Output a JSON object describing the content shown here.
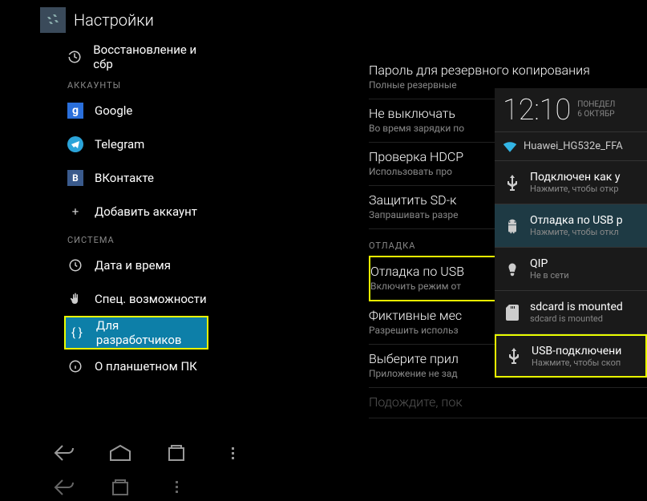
{
  "header": {
    "title": "Настройки"
  },
  "sidebar": {
    "restore": "Восстановление и сбр",
    "sections": {
      "accounts": "Аккаунты",
      "system": "Система"
    },
    "google": "Google",
    "telegram": "Telegram",
    "vk": "ВКонтакте",
    "add_account": "Добавить аккаунт",
    "datetime": "Дата и время",
    "accessibility": "Спец. возможности",
    "developer": "Для разработчиков",
    "about": "О планшетном ПК"
  },
  "content": {
    "backup_pw": {
      "title": "Пароль для резервного копирования",
      "sub": "Полные резервные"
    },
    "stayawake": {
      "title": "Не выключать",
      "sub": "Во время зарядки по"
    },
    "hdcp": {
      "title": "Проверка HDCP",
      "sub": "Использовать про"
    },
    "protect_sd": {
      "title": "Защитить SD-к",
      "sub": "Запрашивать разре"
    },
    "section_debug": "ОТЛАДКА",
    "usb_debug": {
      "title": "Отладка по USB",
      "sub": "Включить режим от"
    },
    "mock_loc": {
      "title": "Фиктивные мес",
      "sub": "Разрешить использ"
    },
    "choose_app": {
      "title": "Выберите прил",
      "sub": "Приложение не зад"
    },
    "wait": {
      "title": "Подождите, пок"
    }
  },
  "clock": {
    "time": "12:10",
    "day": "ПОНЕДЕЛ",
    "date": "6 ОКТЯБР"
  },
  "wifi": "Huawei_HG532e_FFA",
  "notifications": {
    "connected": {
      "title": "Подключен как у",
      "sub": "Нажмите, чтобы откр"
    },
    "usb_debug": {
      "title": "Отладка по USB р",
      "sub": "Нажмите, чтобы откл"
    },
    "qip": {
      "title": "QIP",
      "sub": "Не в сети"
    },
    "sdcard": {
      "title": "sdcard is mounted",
      "sub": "sdcard is mounted"
    },
    "usb_conn": {
      "title": "USB-подключени",
      "sub": "Нажмите, чтобы скоп"
    }
  }
}
